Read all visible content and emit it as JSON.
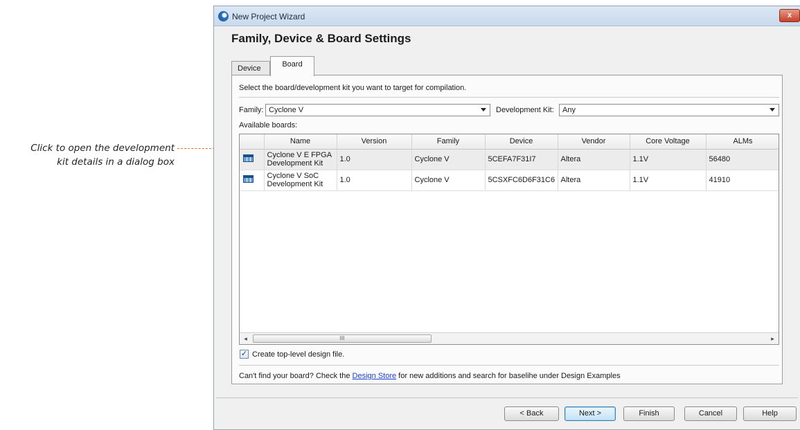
{
  "callout": {
    "line1": "Click to open the development",
    "line2": "kit details in a dialog box"
  },
  "window": {
    "title": "New Project Wizard",
    "close_label": "x",
    "page_title": "Family, Device & Board Settings"
  },
  "tabs": [
    {
      "label": "Device",
      "active": false
    },
    {
      "label": "Board",
      "active": true
    }
  ],
  "instruction": "Select the board/development kit you want to target for compilation.",
  "family": {
    "label": "Family:",
    "value": "Cyclone V"
  },
  "dev_kit": {
    "label": "Development Kit:",
    "value": "Any"
  },
  "available_label": "Available boards:",
  "table": {
    "columns": [
      "",
      "Name",
      "Version",
      "Family",
      "Device",
      "Vendor",
      "Core Voltage",
      "ALMs"
    ],
    "rows": [
      {
        "name_line1": "Cyclone V E FPGA",
        "name_line2": "Development Kit",
        "version": "1.0",
        "family": "Cyclone V",
        "device": "5CEFA7F31I7",
        "vendor": "Altera",
        "core_voltage": "1.1V",
        "alms": "56480"
      },
      {
        "name_line1": "Cyclone V SoC",
        "name_line2": "Development Kit",
        "version": "1.0",
        "family": "Cyclone V",
        "device": "5CSXFC6D6F31C6",
        "vendor": "Altera",
        "core_voltage": "1.1V",
        "alms": "41910"
      }
    ]
  },
  "scrollbar": {
    "left": "◂",
    "right": "▸",
    "grip": "III"
  },
  "create_top_level": {
    "checked": true,
    "label": "Create top-level design file.",
    "mark": "✓"
  },
  "footer": {
    "prefix": "Can't find your board? Check the ",
    "link": "Design Store",
    "suffix": " for new additions and search for baselihe under Design Examples"
  },
  "buttons": {
    "back": "< Back",
    "next": "Next >",
    "finish": "Finish",
    "cancel": "Cancel",
    "help": "Help"
  }
}
